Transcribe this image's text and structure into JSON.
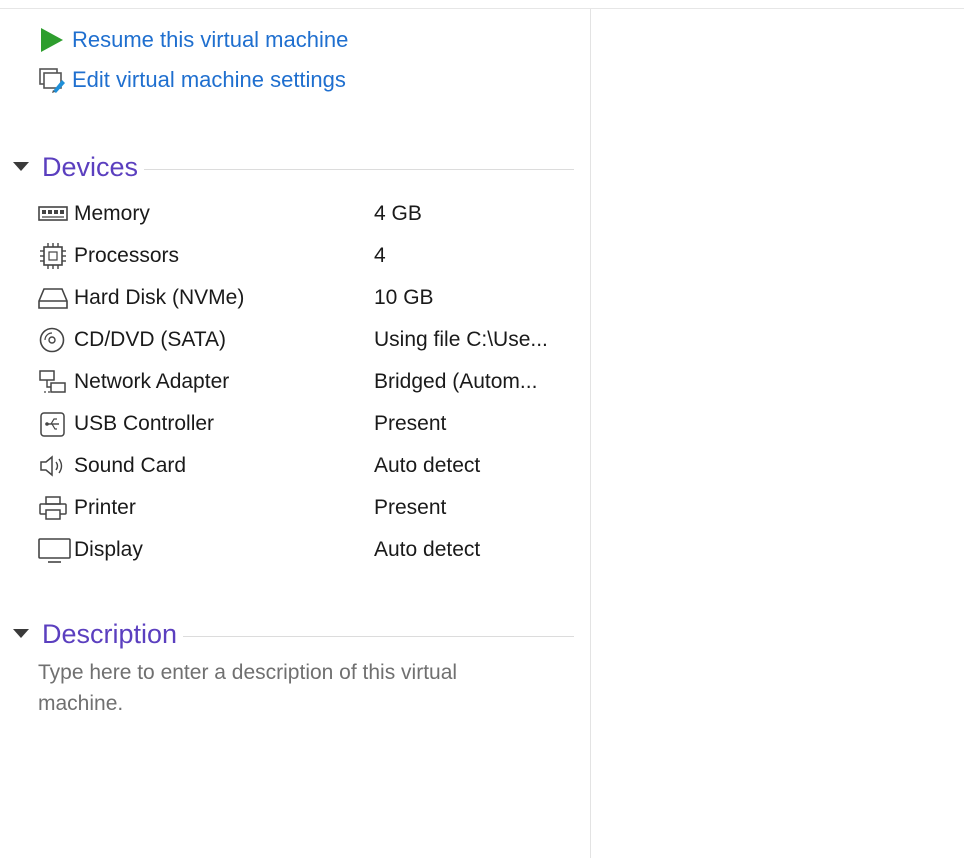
{
  "commands": {
    "resume": "Resume this virtual machine",
    "edit": "Edit virtual machine settings"
  },
  "sections": {
    "devices": "Devices",
    "description": "Description"
  },
  "devices": [
    {
      "name": "Memory",
      "value": "4 GB",
      "icon": "memory-icon"
    },
    {
      "name": "Processors",
      "value": "4",
      "icon": "processor-icon"
    },
    {
      "name": "Hard Disk (NVMe)",
      "value": "10 GB",
      "icon": "hard-disk-icon"
    },
    {
      "name": "CD/DVD (SATA)",
      "value": "Using file C:\\Use...",
      "icon": "cd-dvd-icon"
    },
    {
      "name": "Network Adapter",
      "value": "Bridged (Autom...",
      "icon": "network-adapter-icon"
    },
    {
      "name": "USB Controller",
      "value": "Present",
      "icon": "usb-icon"
    },
    {
      "name": "Sound Card",
      "value": "Auto detect",
      "icon": "speaker-icon"
    },
    {
      "name": "Printer",
      "value": "Present",
      "icon": "printer-icon"
    },
    {
      "name": "Display",
      "value": "Auto detect",
      "icon": "display-icon"
    }
  ],
  "description": {
    "placeholder": "Type here to enter a description of this virtual machine."
  },
  "colors": {
    "link": "#1f6fcf",
    "section_title": "#5b3fbf",
    "play": "#2e9e2e",
    "placeholder_text": "#707070"
  }
}
